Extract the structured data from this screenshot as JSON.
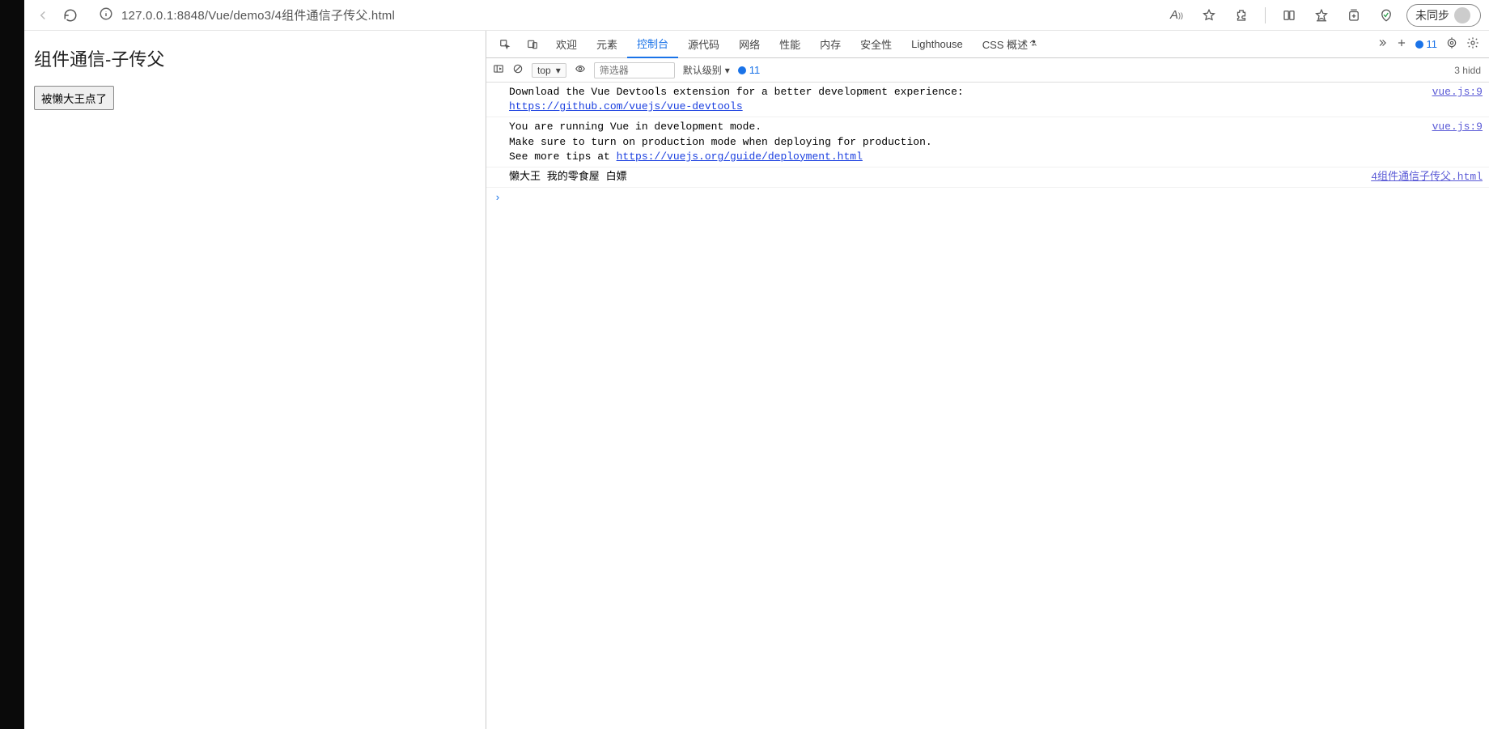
{
  "browser": {
    "url": "127.0.0.1:8848/Vue/demo3/4组件通信子传父.html",
    "read_aloud": "A",
    "sync_label": "未同步"
  },
  "page": {
    "title": "组件通信-子传父",
    "button_label": "被懒大王点了"
  },
  "devtools": {
    "tabs": [
      "欢迎",
      "元素",
      "控制台",
      "源代码",
      "网络",
      "性能",
      "内存",
      "安全性",
      "Lighthouse"
    ],
    "css_overview_label": "CSS 概述",
    "active_tab_index": 2,
    "issues_count": "11",
    "filterbar": {
      "context": "top",
      "filter_placeholder": "筛选器",
      "level_label": "默认级别",
      "info_count": "11",
      "hidden_label": "3 hidd"
    },
    "logs": [
      {
        "lines": [
          {
            "text": "Download the Vue Devtools extension for a better development experience:",
            "link": false
          },
          {
            "text": "https://github.com/vuejs/vue-devtools",
            "link": true
          }
        ],
        "source": "vue.js:9"
      },
      {
        "lines": [
          {
            "text": "You are running Vue in development mode.",
            "link": false
          },
          {
            "text": "Make sure to turn on production mode when deploying for production.",
            "link": false
          },
          {
            "text_prefix": "See more tips at ",
            "text": "https://vuejs.org/guide/deployment.html",
            "link": true
          }
        ],
        "source": "vue.js:9"
      },
      {
        "lines": [
          {
            "text": "懒大王 我的零食屋 白嫖",
            "link": false
          }
        ],
        "source": "4组件通信子传父.html"
      }
    ]
  }
}
